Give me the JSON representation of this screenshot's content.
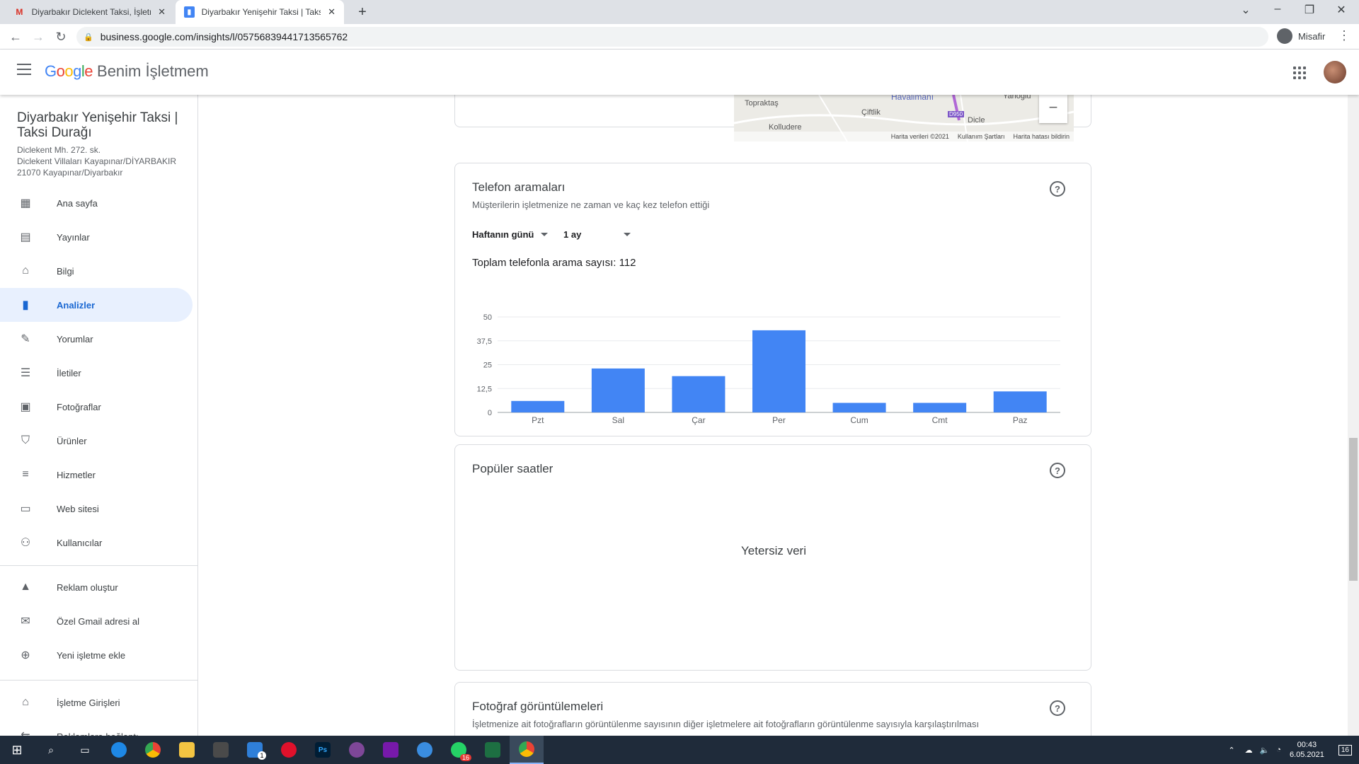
{
  "browser": {
    "tabs": [
      {
        "title": "Diyarbakır Diclekent Taksi, İşletm",
        "favicon": "gmail-icon",
        "active": false
      },
      {
        "title": "Diyarbakır Yenişehir Taksi | Taksi D",
        "favicon": "gmb-icon",
        "active": true
      }
    ],
    "url": "business.google.com/insights/l/05756839441713565762",
    "profile_label": "Misafir"
  },
  "appbar": {
    "brand_google": "Google",
    "brand_product": "Benim İşletmem"
  },
  "sidebar": {
    "business_name": "Diyarbakır Yenişehir Taksi | Taksi Durağı",
    "address_lines": [
      "Diclekent Mh. 272. sk.",
      "Diclekent Villaları Kayapınar/DİYARBAKIR",
      "21070 Kayapınar/Diyarbakır"
    ],
    "items": [
      {
        "label": "Ana sayfa",
        "icon": "dashboard-icon"
      },
      {
        "label": "Yayınlar",
        "icon": "posts-icon"
      },
      {
        "label": "Bilgi",
        "icon": "storefront-icon"
      },
      {
        "label": "Analizler",
        "icon": "insights-icon",
        "active": true
      },
      {
        "label": "Yorumlar",
        "icon": "reviews-icon"
      },
      {
        "label": "İletiler",
        "icon": "messages-icon"
      },
      {
        "label": "Fotoğraflar",
        "icon": "photos-icon"
      },
      {
        "label": "Ürünler",
        "icon": "products-basket-icon"
      },
      {
        "label": "Hizmetler",
        "icon": "services-list-icon"
      },
      {
        "label": "Web sitesi",
        "icon": "website-icon"
      },
      {
        "label": "Kullanıcılar",
        "icon": "add-user-icon"
      }
    ],
    "extra_items": [
      {
        "label": "Reklam oluştur",
        "icon": "google-ads-icon"
      },
      {
        "label": "Özel Gmail adresi al",
        "icon": "gmail-envelope-icon"
      },
      {
        "label": "Yeni işletme ekle",
        "icon": "add-location-icon"
      }
    ],
    "bottom_items": [
      {
        "label": "İşletme Girişleri",
        "icon": "store-icon"
      },
      {
        "label": "Reklamlara bağlantı",
        "icon": "link-icon"
      }
    ]
  },
  "map": {
    "labels": [
      "Havalimanı",
      "Topraktaş",
      "Çiftlik",
      "Dicle",
      "Kolludere",
      "Yanoğlu",
      "D950"
    ],
    "footer": [
      "Harita verileri ©2021",
      "Kullanım Şartları",
      "Harita hatası bildirin"
    ]
  },
  "calls_card": {
    "title": "Telefon aramaları",
    "subtitle": "Müşterilerin işletmenize ne zaman ve kaç kez telefon ettiği",
    "dropdown_grouping": "Haftanın günü",
    "dropdown_range": "1 ay",
    "total_text": "Toplam telefonla arama sayısı: 112"
  },
  "chart_data": {
    "type": "bar",
    "categories": [
      "Pzt",
      "Sal",
      "Çar",
      "Per",
      "Cum",
      "Cmt",
      "Paz"
    ],
    "values": [
      6,
      23,
      19,
      43,
      5,
      5,
      11
    ],
    "ylim": [
      0,
      50
    ],
    "yticks": [
      "0",
      "12,5",
      "25",
      "37,5",
      "50"
    ],
    "ytick_values": [
      0,
      12.5,
      25,
      37.5,
      50
    ],
    "grid": true,
    "bar_color": "#4285f4"
  },
  "popular_card": {
    "title": "Popüler saatler",
    "empty_text": "Yetersiz veri"
  },
  "photos_card": {
    "title": "Fotoğraf görüntülemeleri",
    "subtitle": "İşletmenize ait fotoğrafların görüntülenme sayısının diğer işletmelere ait fotoğrafların görüntülenme sayısıyla karşılaştırılması"
  },
  "taskbar": {
    "time": "00:43",
    "date": "6.05.2021",
    "notification_count": "16",
    "mail_badge": "1",
    "whatsapp_badge": "16"
  },
  "colors": {
    "accent": "#1967d2",
    "active_bg": "#e8f0fe",
    "bar": "#4285f4"
  }
}
